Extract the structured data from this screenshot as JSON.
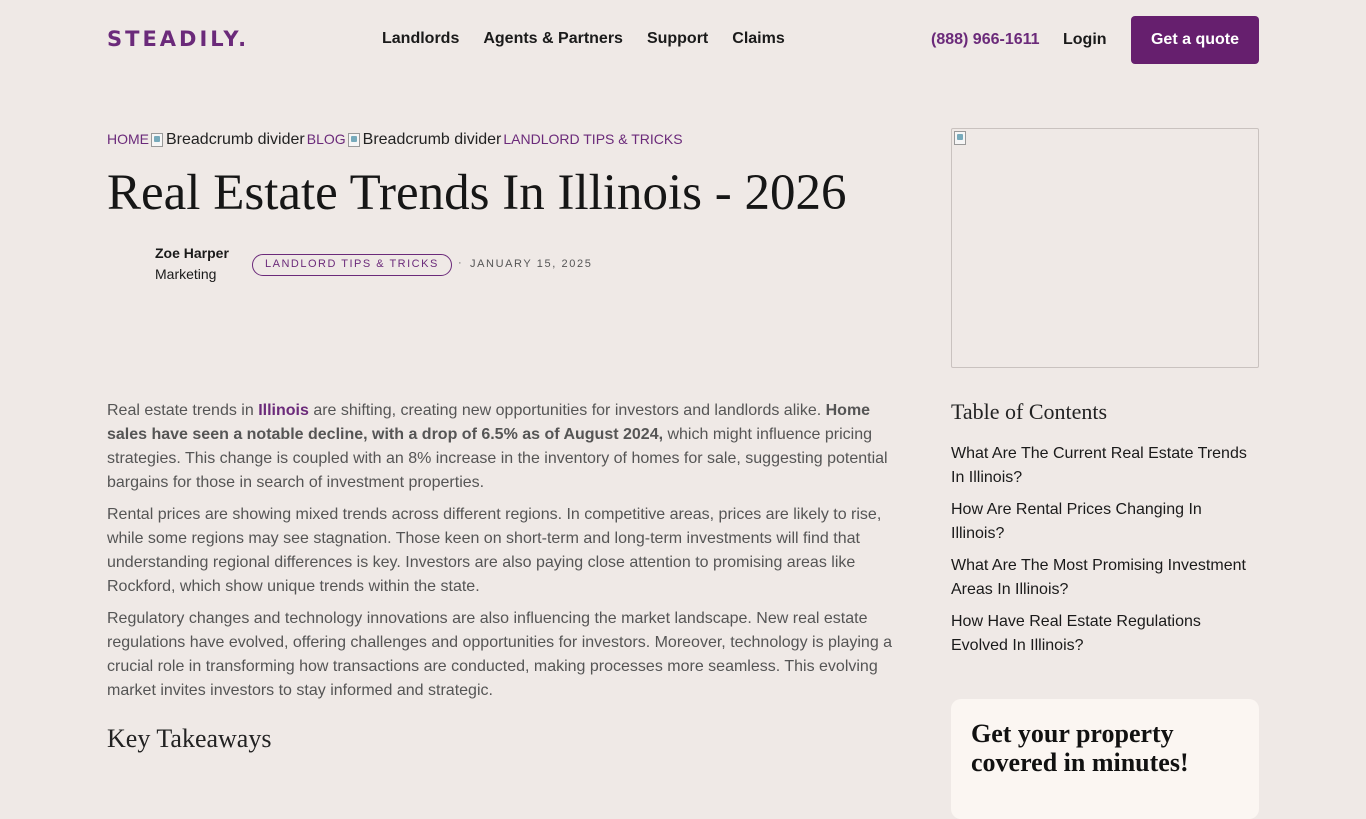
{
  "header": {
    "logo": "STEADILY.",
    "nav": [
      "Landlords",
      "Agents & Partners",
      "Support",
      "Claims"
    ],
    "phone": "(888) 966-1611",
    "login": "Login",
    "cta": "Get a quote"
  },
  "breadcrumb": {
    "home": "HOME",
    "divider_alt": "Breadcrumb divider",
    "blog": "BLOG",
    "category": "LANDLORD TIPS & TRICKS"
  },
  "article": {
    "title": "Real Estate Trends In Illinois - 2026",
    "author_name": "Zoe Harper",
    "author_role": "Marketing",
    "tag": "LANDLORD TIPS & TRICKS",
    "separator": "·",
    "date": "JANUARY 15, 2025",
    "p1_a": "Real estate trends in ",
    "p1_link": "Illinois",
    "p1_b": " are shifting, creating new opportunities for investors and landlords alike. ",
    "p1_bold": "Home sales have seen a notable decline, with a drop of 6.5% as of August 2024,",
    "p1_c": " which might influence pricing strategies. This change is coupled with an 8% increase in the inventory of homes for sale, suggesting potential bargains for those in search of investment properties.",
    "p2": "Rental prices are showing mixed trends across different regions. In competitive areas, prices are likely to rise, while some regions may see stagnation. Those keen on short-term and long-term investments will find that understanding regional differences is key. Investors are also paying close attention to promising areas like Rockford, which show unique trends within the state.",
    "p3": "Regulatory changes and technology innovations are also influencing the market landscape. New real estate regulations have evolved, offering challenges and opportunities for investors. Moreover, technology is playing a crucial role in transforming how transactions are conducted, making processes more seamless. This evolving market invites investors to stay informed and strategic.",
    "key_takeaways": "Key Takeaways"
  },
  "sidebar": {
    "toc_title": "Table of Contents",
    "toc": [
      "What Are The Current Real Estate Trends In Illinois?",
      "How Are Rental Prices Changing In Illinois?",
      "What Are The Most Promising Investment Areas In Illinois?",
      "How Have Real Estate Regulations Evolved In Illinois?"
    ],
    "cta_title": "Get your property covered in minutes!"
  },
  "colors": {
    "brand": "#6b2a7a",
    "button": "#661f6e",
    "background": "#efe9e6"
  }
}
